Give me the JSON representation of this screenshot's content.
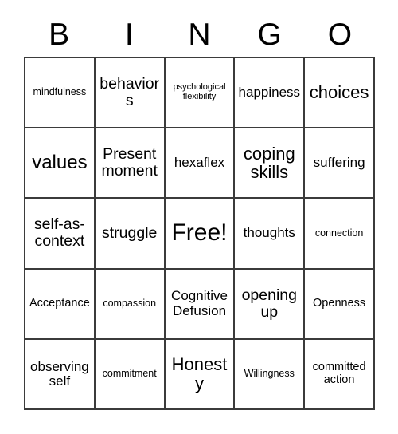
{
  "card": {
    "title": "BINGO",
    "header_letters": [
      "B",
      "I",
      "N",
      "G",
      "O"
    ],
    "colors": {
      "background": "#ffffff",
      "text": "#000000",
      "grid_line": "#3b3b3b"
    },
    "grid_size": "5x5",
    "free_space": "Free!",
    "rows": [
      [
        {
          "text": "mindfulness",
          "size": "sm"
        },
        {
          "text": "behaviors",
          "size": "xl"
        },
        {
          "text": "psychological flexibility",
          "size": "xs"
        },
        {
          "text": "happiness",
          "size": "lg"
        },
        {
          "text": "choices",
          "size": "xxl"
        }
      ],
      [
        {
          "text": "values",
          "size": "huge"
        },
        {
          "text": "Present moment",
          "size": "xl"
        },
        {
          "text": "hexaflex",
          "size": "lg"
        },
        {
          "text": "coping skills",
          "size": "xxl"
        },
        {
          "text": "suffering",
          "size": "lg"
        }
      ],
      [
        {
          "text": "self-as-context",
          "size": "xl"
        },
        {
          "text": "struggle",
          "size": "xl"
        },
        {
          "text": "Free!",
          "size": "free"
        },
        {
          "text": "thoughts",
          "size": "lg"
        },
        {
          "text": "connection",
          "size": "sm"
        }
      ],
      [
        {
          "text": "Acceptance",
          "size": "md"
        },
        {
          "text": "compassion",
          "size": "sm"
        },
        {
          "text": "Cognitive Defusion",
          "size": "lg"
        },
        {
          "text": "opening up",
          "size": "xl"
        },
        {
          "text": "Openness",
          "size": "md"
        }
      ],
      [
        {
          "text": "observing self",
          "size": "lg"
        },
        {
          "text": "commitment",
          "size": "sm"
        },
        {
          "text": "Honesty",
          "size": "xxl"
        },
        {
          "text": "Willingness",
          "size": "sm"
        },
        {
          "text": "committed action",
          "size": "md"
        }
      ]
    ]
  }
}
